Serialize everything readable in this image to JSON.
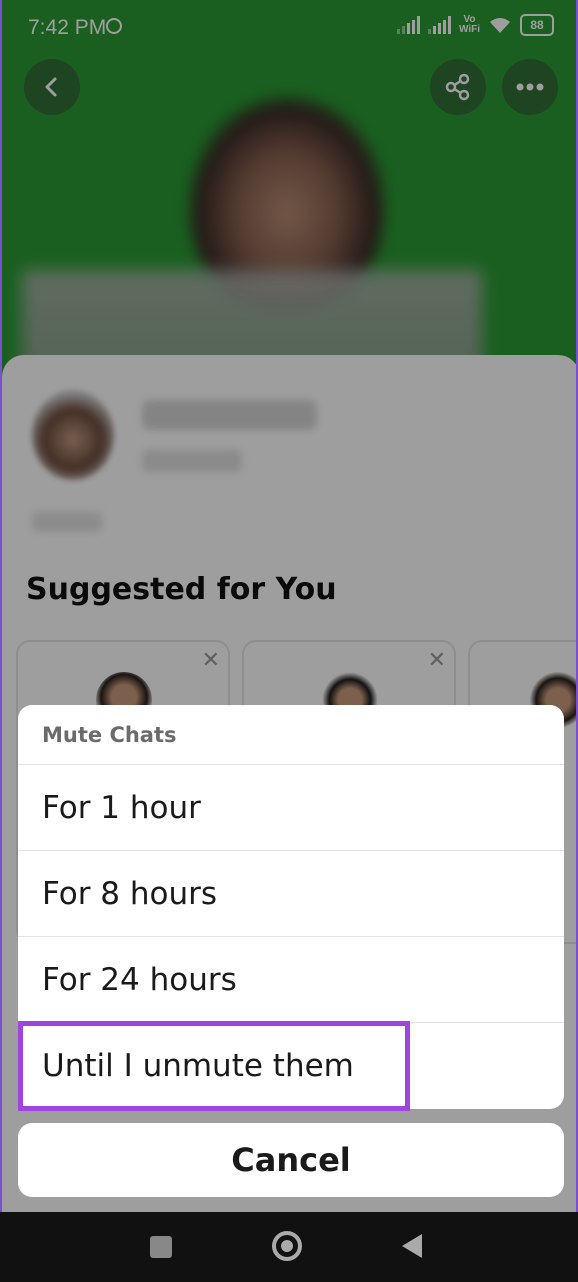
{
  "status_bar": {
    "time": "7:42 PM",
    "network_label": "Vo\nWiFi",
    "battery": "88"
  },
  "profile": {
    "suggested_title": "Suggested for You"
  },
  "mute_sheet": {
    "header": "Mute Chats",
    "options": [
      "For 1 hour",
      "For 8 hours",
      "For 24 hours",
      "Until I unmute them"
    ],
    "cancel_label": "Cancel",
    "highlighted_option_index": 3
  },
  "colors": {
    "hero_green": "#2a9a34",
    "highlight_purple": "#a044e0"
  },
  "icons": {
    "back": "chevron-left-icon",
    "share": "share-icon",
    "more": "more-horizontal-icon",
    "close": "close-icon"
  }
}
